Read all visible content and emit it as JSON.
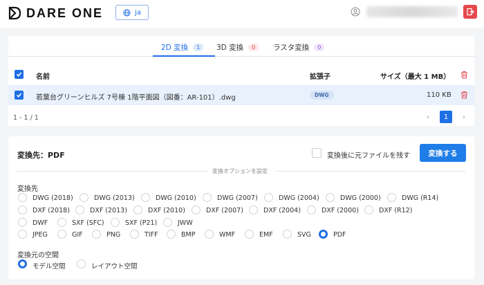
{
  "header": {
    "logo_text": "DARE ONE",
    "lang_label": "ja"
  },
  "tabs": [
    {
      "label": "2D 変換",
      "count": "1"
    },
    {
      "label": "3D 変換",
      "count": "0"
    },
    {
      "label": "ラスタ変換",
      "count": "0"
    }
  ],
  "table": {
    "col_name": "名前",
    "col_ext": "拡張子",
    "col_size": "サイズ（最大 1 MB）",
    "rows": [
      {
        "name": "若葉台グリーンヒルズ 7号棟 1階平面図（図番：AR-101）.dwg",
        "ext": "DWG",
        "size": "110 KB"
      }
    ]
  },
  "pagination": {
    "range": "1 - 1 / 1",
    "current": "1"
  },
  "convert": {
    "title": "変換先：PDF",
    "keep_label": "変換後に元ファイルを残す",
    "button": "変換する",
    "options_label": "変換オプションを設定",
    "target_label": "変換先",
    "formats_row1": [
      "DWG (2018)",
      "DWG (2013)",
      "DWG (2010)",
      "DWG (2007)",
      "DWG (2004)",
      "DWG (2000)",
      "DWG (R14)"
    ],
    "formats_row2": [
      "DXF (2018)",
      "DXF (2013)",
      "DXF (2010)",
      "DXF (2007)",
      "DXF (2004)",
      "DXF (2000)",
      "DXF (R12)"
    ],
    "formats_row3": [
      "DWF",
      "SXF (SFC)",
      "SXF (P21)",
      "JWW"
    ],
    "formats_row4": [
      "JPEG",
      "GIF",
      "PNG",
      "TIFF",
      "BMP",
      "WMF",
      "EMF",
      "SVG",
      "PDF"
    ],
    "selected_format": "PDF",
    "space_label": "変換元の空間",
    "spaces": [
      "モデル空間",
      "レイアウト空間"
    ],
    "selected_space": "モデル空間"
  },
  "colors": {
    "accent": "#1f6fe5",
    "danger": "#e5484d",
    "row_highlight": "#e9f1fc"
  }
}
